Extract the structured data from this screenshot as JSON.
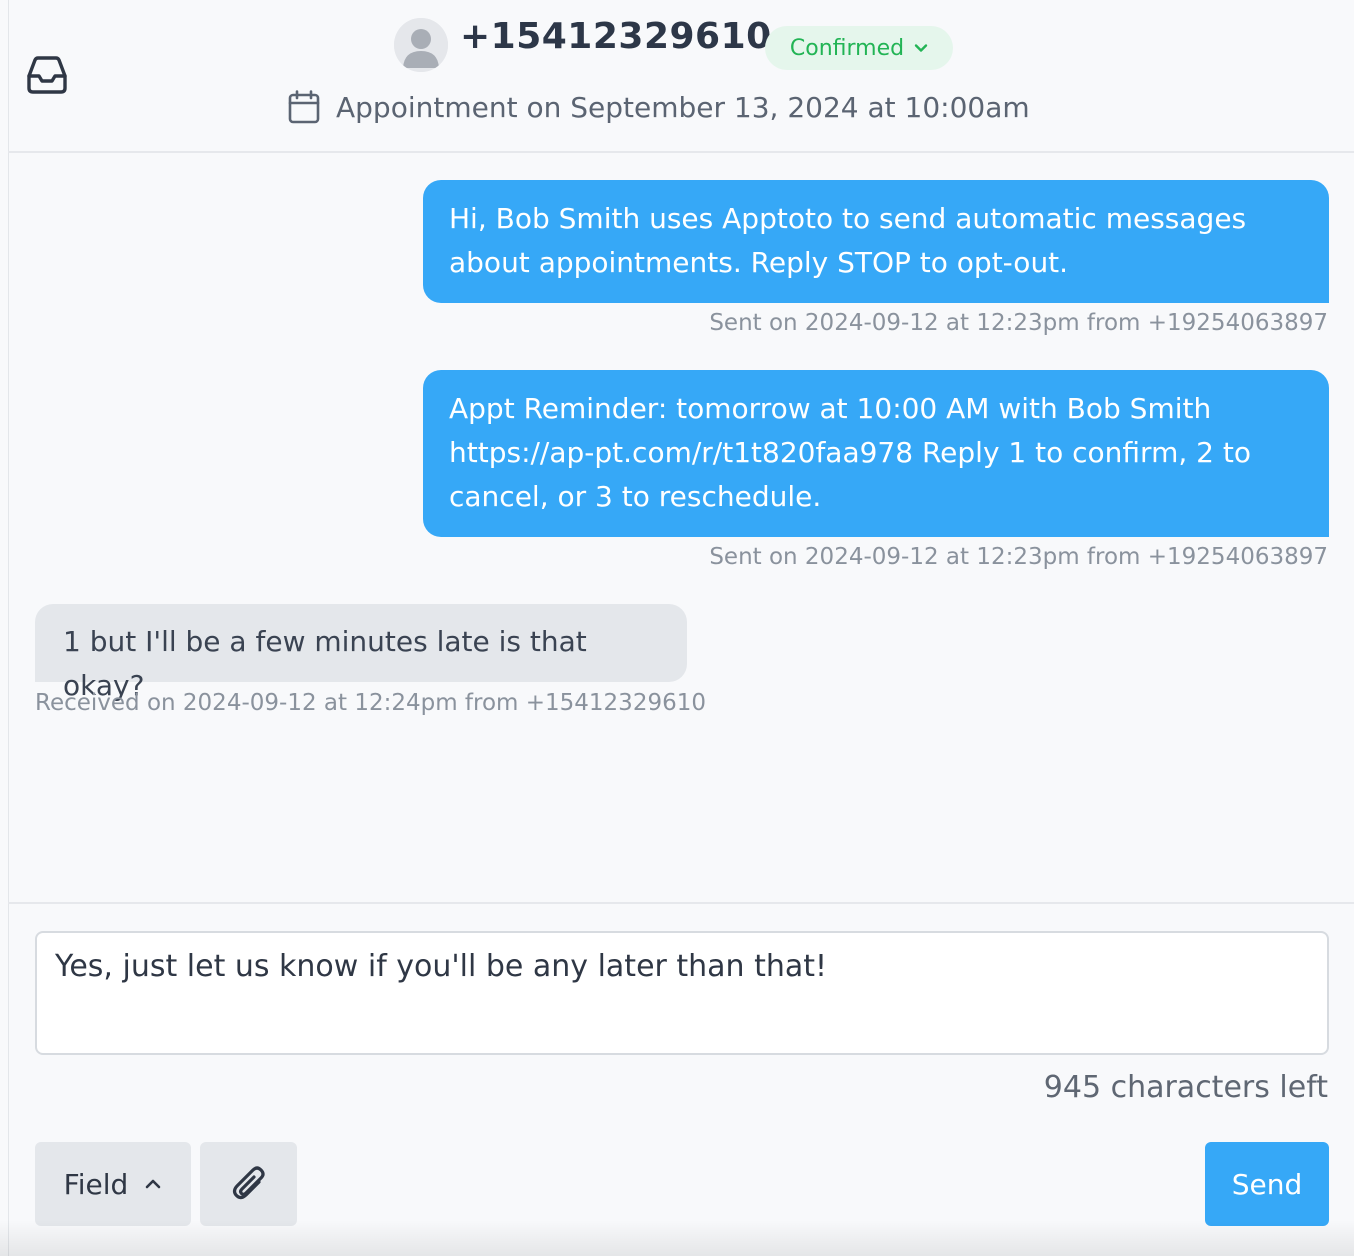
{
  "header": {
    "contact_phone": "+15412329610",
    "status": "Confirmed",
    "appointment": "Appointment on September 13, 2024 at  10:00am"
  },
  "icons": {
    "inbox": "inbox-icon",
    "avatar": "user-avatar-icon",
    "status_menu": "chevron-down-icon",
    "calendar": "calendar-icon",
    "field_menu": "chevron-up-icon",
    "attach": "paperclip-icon"
  },
  "messages": [
    {
      "direction": "outgoing",
      "text": "Hi, Bob Smith uses Apptoto to send automatic messages about appointments. Reply STOP to opt-out.",
      "meta": "Sent on 2024-09-12 at 12:23pm from +19254063897"
    },
    {
      "direction": "outgoing",
      "text": "Appt Reminder: tomorrow at 10:00 AM with Bob Smith https://ap-pt.com/r/t1t820faa978 Reply 1 to confirm, 2 to cancel, or 3 to reschedule.",
      "meta": "Sent on 2024-09-12 at 12:23pm from +19254063897"
    },
    {
      "direction": "incoming",
      "text": "1 but I'll be a few minutes late is that okay?",
      "meta": "Received on 2024-09-12 at 12:24pm from +15412329610"
    }
  ],
  "composer": {
    "value": "Yes, just let us know if you'll be any later than that!",
    "chars_left": "945 characters left",
    "field_label": "Field",
    "send_label": "Send"
  },
  "colors": {
    "accent": "#36a8f7",
    "status_green": "#22b455",
    "status_bg": "#e5f6ec",
    "incoming_bg": "#e4e7eb"
  }
}
